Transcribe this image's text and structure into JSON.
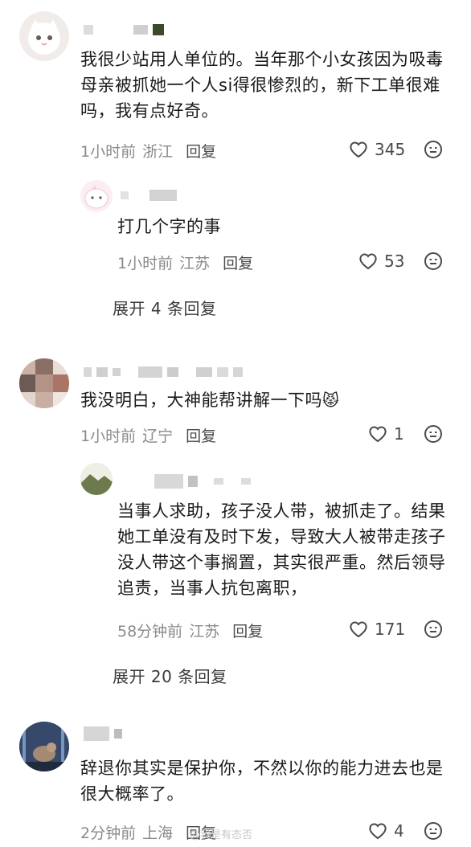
{
  "comments": [
    {
      "text": "我很少站用人单位的。当年那个小女孩因为吸毒母亲被抓她一个人si得很惨烈的，新下工单很难吗，我有点好奇。",
      "time": "1小时前",
      "location": "浙江",
      "reply_label": "回复",
      "likes": "345",
      "sub": {
        "text": "打几个字的事",
        "time": "1小时前",
        "location": "江苏",
        "reply_label": "回复",
        "likes": "53"
      },
      "expand": "展开 4 条回复"
    },
    {
      "text": "我没明白，大神能帮讲解一下吗",
      "emoji": "😾",
      "time": "1小时前",
      "location": "辽宁",
      "reply_label": "回复",
      "likes": "1",
      "sub": {
        "text": "当事人求助，孩子没人带，被抓走了。结果她工单没有及时下发，导致大人被带走孩子没人带这个事搁置，其实很严重。然后领导追责，当事人抗包离职，",
        "time": "58分钟前",
        "location": "江苏",
        "reply_label": "回复",
        "likes": "171"
      },
      "expand": "展开 20 条回复"
    },
    {
      "text": "辞退你其实是保护你，不然以你的能力进去也是很大概率了。",
      "time": "2分钟前",
      "location": "上海",
      "reply_label": "回复",
      "likes": "4"
    }
  ],
  "watermark": "@我是有态否",
  "icons": {
    "like": "heart-outline-icon",
    "more": "emoji-face-icon"
  },
  "colors": {
    "meta": "#8a8a8a",
    "text": "#1a1a1a",
    "mosaic": "#d6d6d6"
  }
}
